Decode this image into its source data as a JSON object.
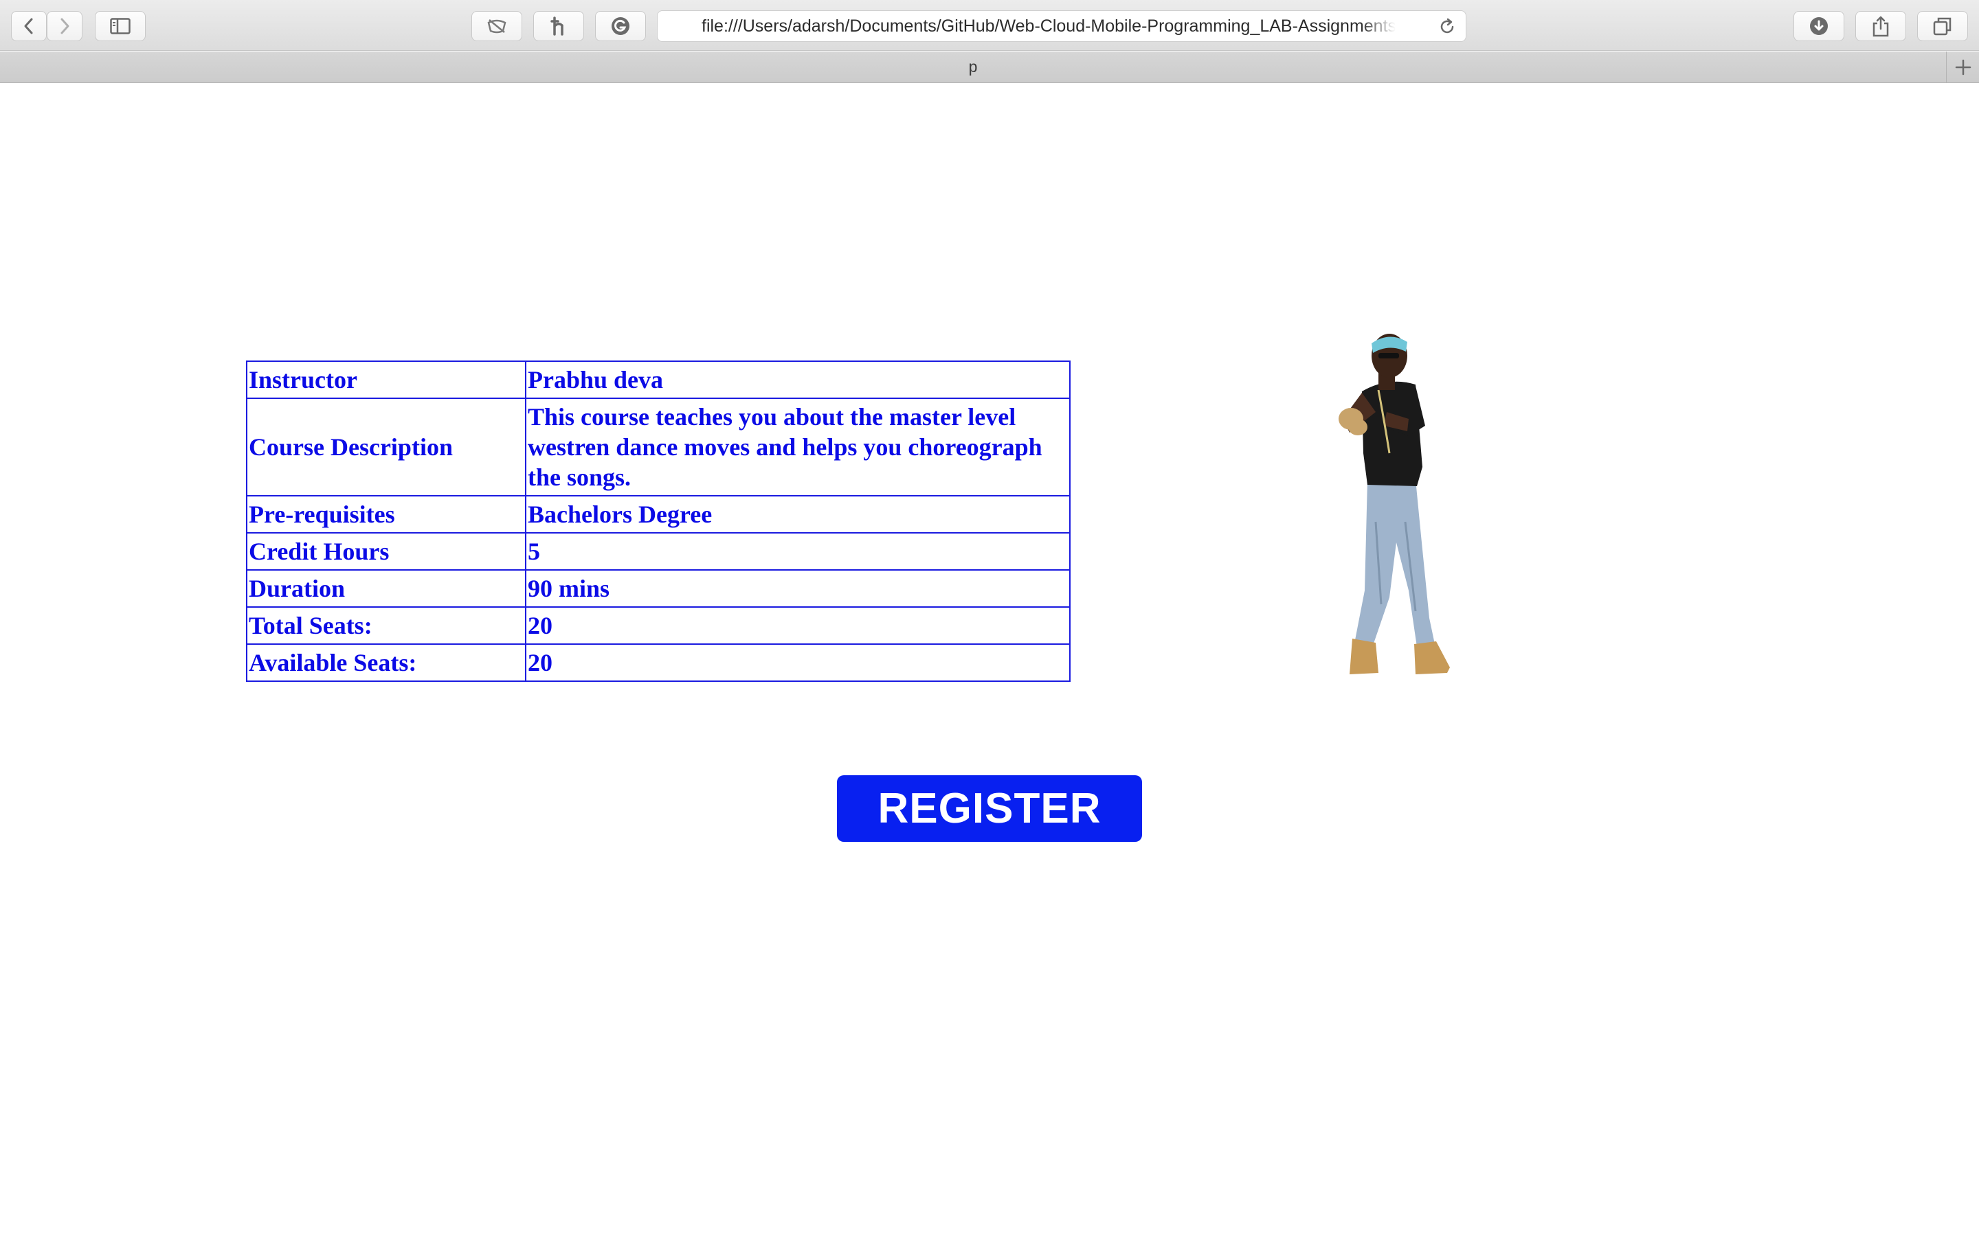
{
  "browser": {
    "url": "file:///Users/adarsh/Documents/GitHub/Web-Cloud-Mobile-Programming_LAB-Assignments/",
    "tab_title": "p"
  },
  "course": {
    "rows": [
      {
        "label": "Instructor",
        "value": "Prabhu deva"
      },
      {
        "label": "Course Description",
        "value": "This course teaches you about the master level westren dance moves and helps you choreograph the songs."
      },
      {
        "label": "Pre-requisites",
        "value": "Bachelors Degree"
      },
      {
        "label": "Credit Hours",
        "value": "5"
      },
      {
        "label": "Duration",
        "value": "90 mins"
      },
      {
        "label": "Total Seats:",
        "value": "20"
      },
      {
        "label": "Available Seats:",
        "value": "20"
      }
    ]
  },
  "register_label": "REGISTER",
  "colors": {
    "text_blue": "#0b0be6",
    "button_blue": "#0820f0"
  },
  "icons": [
    "back-icon",
    "forward-icon",
    "sidebar-icon",
    "tracker-icon",
    "honey-icon",
    "grammarly-icon",
    "reload-icon",
    "download-icon",
    "share-icon",
    "tabs-icon",
    "new-tab-icon"
  ]
}
